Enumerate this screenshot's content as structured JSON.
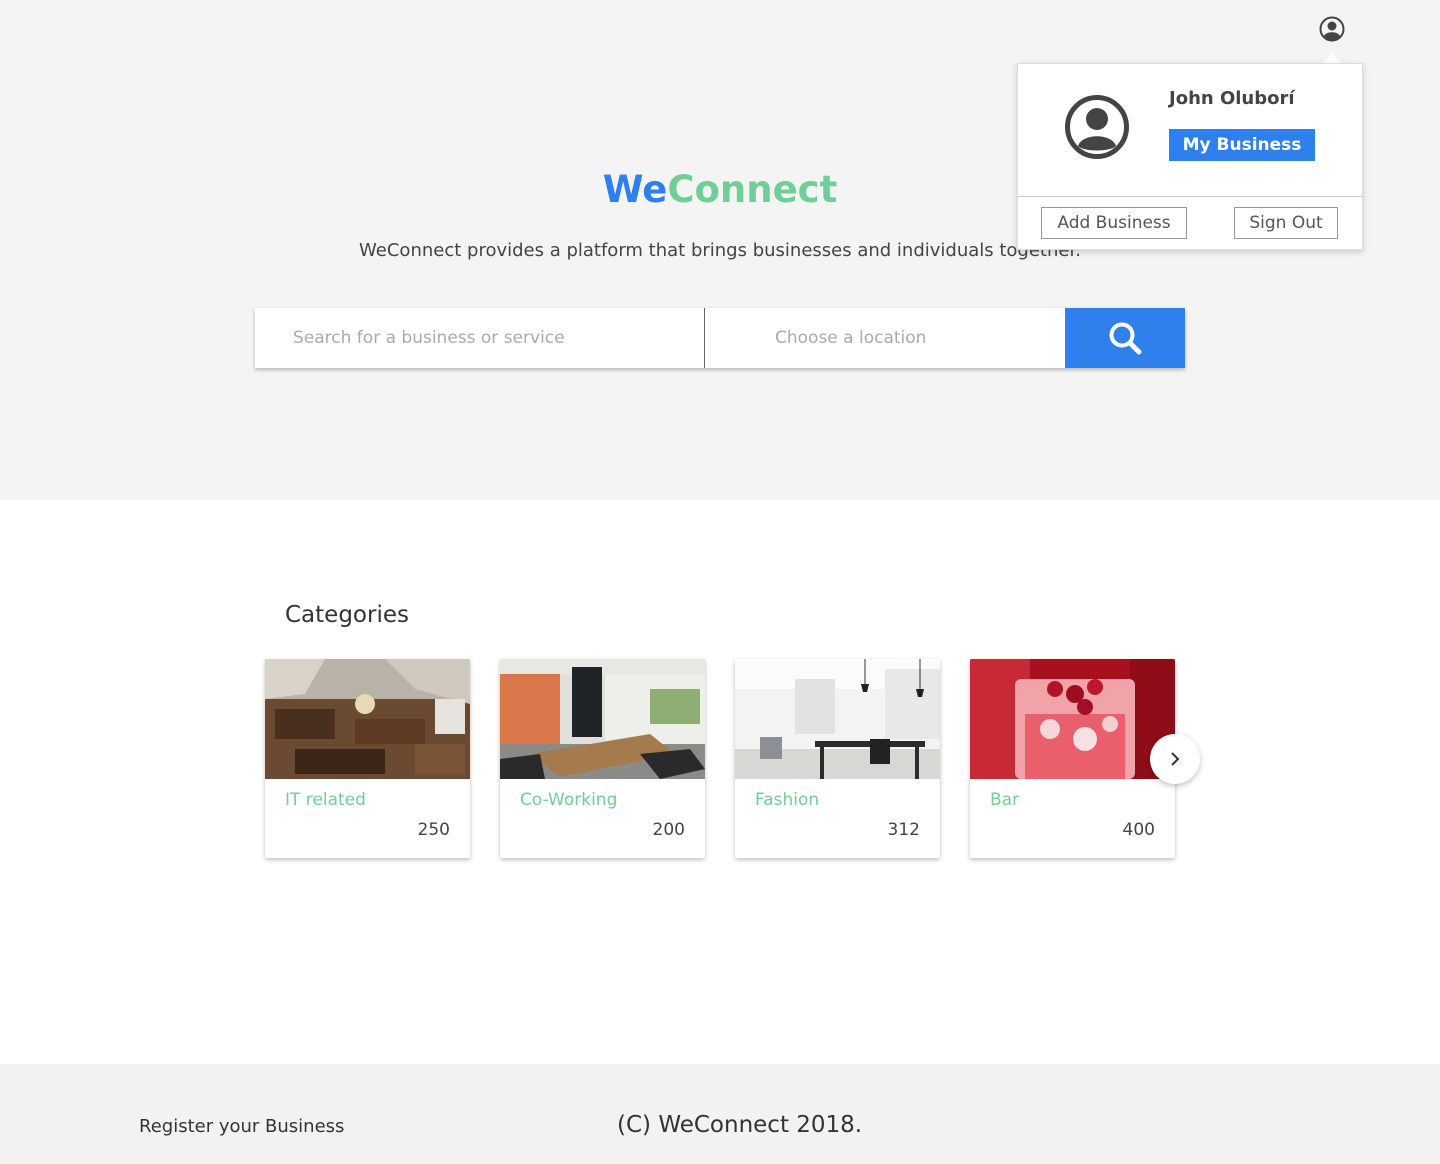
{
  "header": {
    "brand_we": "We",
    "brand_connect": "Connect",
    "tagline": "WeConnect provides a platform that brings businesses and individuals together."
  },
  "search": {
    "query_placeholder": "Search for a business or service",
    "location_placeholder": "Choose a location",
    "button_icon": "search-icon"
  },
  "user_menu": {
    "name": "John Oluborí",
    "my_business_label": "My Business",
    "add_business_label": "Add Business",
    "sign_out_label": "Sign Out",
    "avatar_icon": "user-avatar-icon"
  },
  "categories": {
    "title": "Categories",
    "items": [
      {
        "name": "IT related",
        "count": "250"
      },
      {
        "name": "Co-Working",
        "count": "200"
      },
      {
        "name": "Fashion",
        "count": "312"
      },
      {
        "name": "Bar",
        "count": "400"
      }
    ],
    "next_icon": "chevron-right-icon"
  },
  "footer": {
    "register_link": "Register your Business",
    "copyright": "(C) WeConnect 2018."
  },
  "colors": {
    "primary": "#2f80ed",
    "accent": "#6fcf97",
    "hero_bg": "#f4f4f4",
    "footer_bg": "#f2f2f2"
  }
}
